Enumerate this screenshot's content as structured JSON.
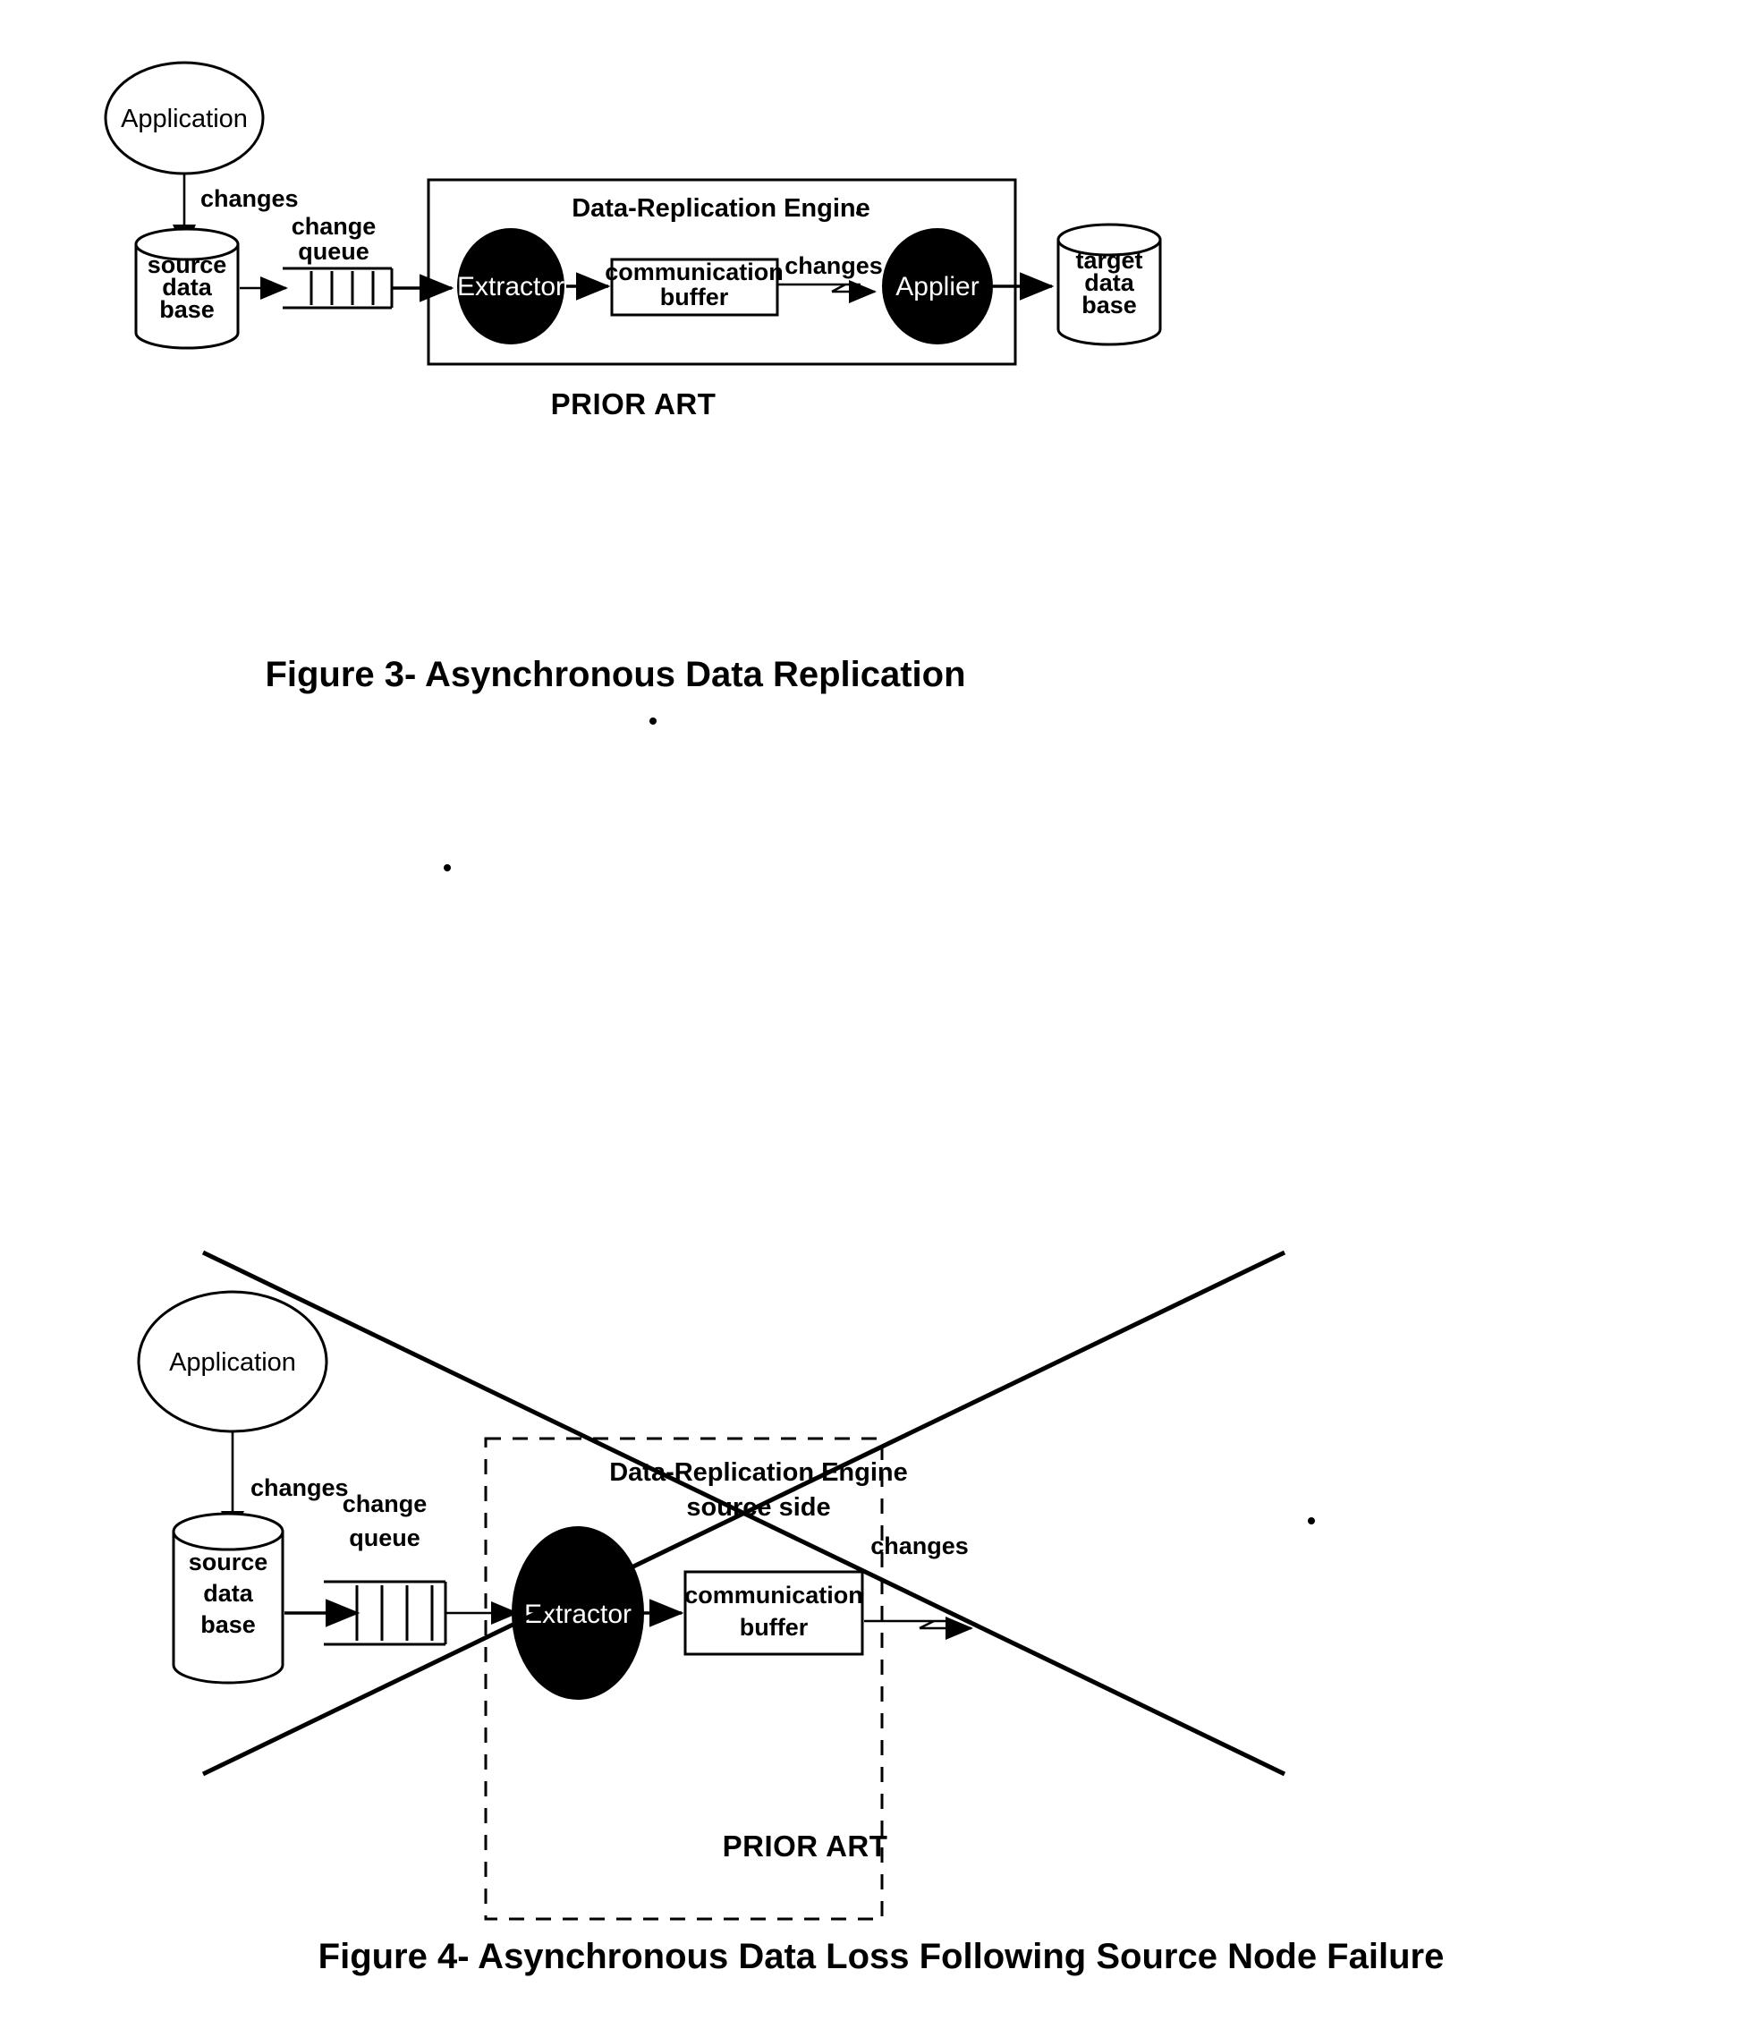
{
  "document": {
    "type": "patent-figure-sheet",
    "figure_count": 2
  },
  "figure3": {
    "caption": "Figure 3- Asynchronous Data Replication",
    "prior_art_label": "PRIOR ART",
    "engine_box_label": "Data-Replication Engine",
    "nodes": {
      "application": "Application",
      "source_database": [
        "source",
        "data",
        "base"
      ],
      "change_queue_label": [
        "change",
        "queue"
      ],
      "extractor": "Extractor",
      "communication_buffer": [
        "communication",
        "buffer"
      ],
      "applier": "Applier",
      "target_database": [
        "target",
        "data",
        "base"
      ]
    },
    "edge_labels": {
      "app_to_source": "changes",
      "buffer_to_applier": "changes"
    },
    "queue_slot_count": 4
  },
  "figure4": {
    "caption": "Figure 4- Asynchronous Data Loss Following Source Node Failure",
    "prior_art_label": "PRIOR ART",
    "engine_box_label": [
      "Data-Replication Engine",
      "source side"
    ],
    "nodes": {
      "application": "Application",
      "source_database": [
        "source",
        "data",
        "base"
      ],
      "change_queue_label": [
        "change",
        "queue"
      ],
      "extractor": "Extractor",
      "communication_buffer": [
        "communication",
        "buffer"
      ]
    },
    "edge_labels": {
      "app_to_source": "changes",
      "buffer_out": "changes"
    },
    "queue_slot_count": 4,
    "failure_overlay": "large X crossing out the whole figure"
  },
  "colors": {
    "ink": "#000000",
    "paper": "#ffffff",
    "node_fill": "#000000",
    "node_text": "#ffffff"
  }
}
